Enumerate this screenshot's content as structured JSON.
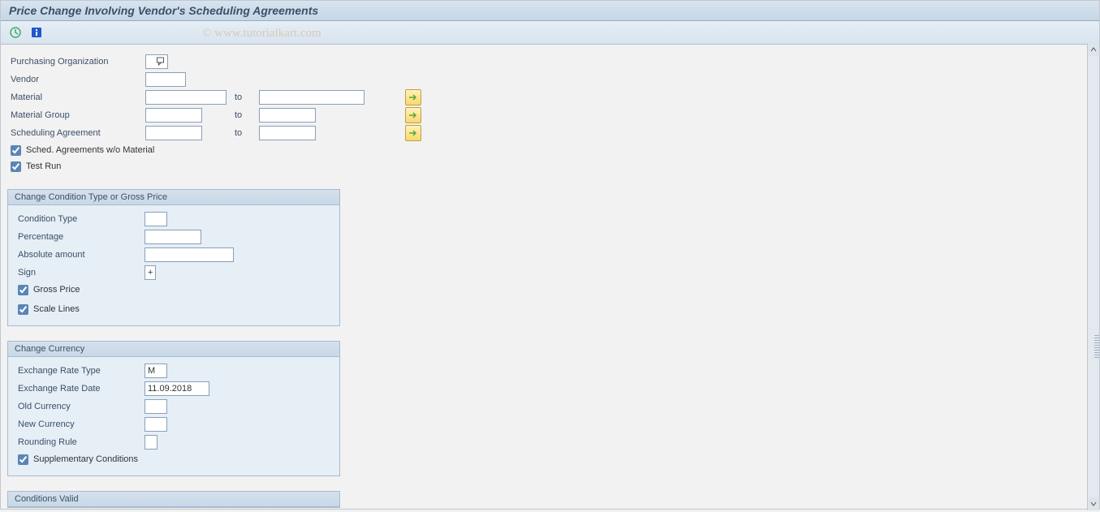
{
  "title": "Price Change Involving Vendor's Scheduling Agreements",
  "watermark": "© www.tutorialkart.com",
  "selection": {
    "purchasing_org_label": "Purchasing Organization",
    "purchasing_org_value": "",
    "vendor_label": "Vendor",
    "vendor_value": "",
    "material_label": "Material",
    "material_to_label": "to",
    "material_low": "",
    "material_high": "",
    "material_group_label": "Material Group",
    "material_group_low": "",
    "material_group_high": "",
    "sched_agreement_label": "Scheduling Agreement",
    "sched_agreement_low": "",
    "sched_agreement_high": "",
    "sched_wo_material_label": "Sched. Agreements w/o Material",
    "sched_wo_material_checked": true,
    "test_run_label": "Test Run",
    "test_run_checked": true
  },
  "condition_box": {
    "title": "Change Condition Type or Gross Price",
    "condition_type_label": "Condition Type",
    "condition_type_value": "",
    "percentage_label": "Percentage",
    "percentage_value": "",
    "absolute_amount_label": "Absolute amount",
    "absolute_amount_value": "",
    "sign_label": "Sign",
    "sign_value": "+",
    "gross_price_label": "Gross Price",
    "gross_price_checked": true,
    "scale_lines_label": "Scale Lines",
    "scale_lines_checked": true
  },
  "currency_box": {
    "title": "Change Currency",
    "exchange_rate_type_label": "Exchange Rate Type",
    "exchange_rate_type_value": "M",
    "exchange_rate_date_label": "Exchange Rate Date",
    "exchange_rate_date_value": "11.09.2018",
    "old_currency_label": "Old Currency",
    "old_currency_value": "",
    "new_currency_label": "New Currency",
    "new_currency_value": "",
    "rounding_rule_label": "Rounding Rule",
    "rounding_rule_value": "",
    "supplementary_label": "Supplementary Conditions",
    "supplementary_checked": true
  },
  "conditions_valid_box": {
    "title": "Conditions Valid"
  }
}
